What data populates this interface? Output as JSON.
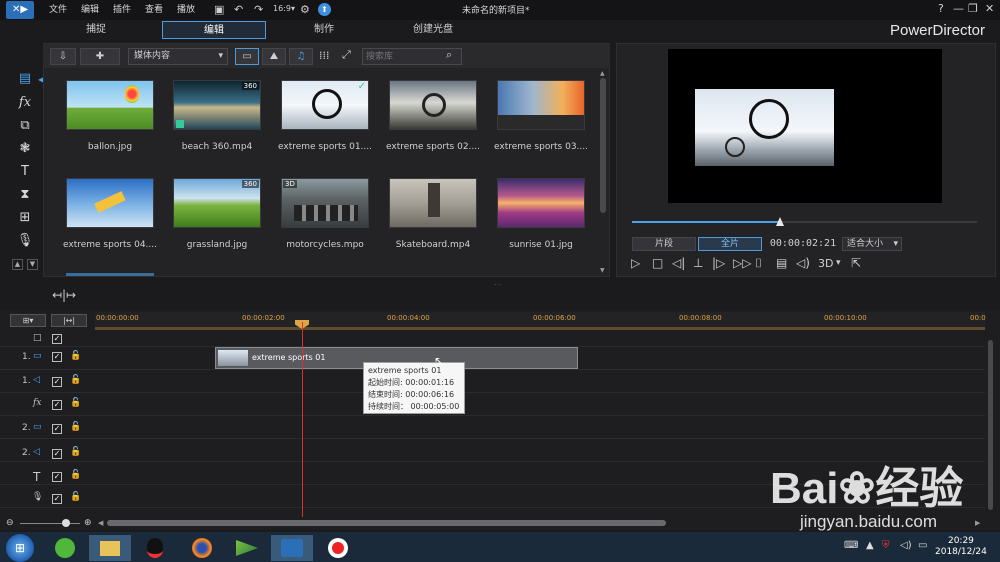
{
  "titlebar": {
    "menus": [
      "文件",
      "编辑",
      "插件",
      "查看",
      "播放"
    ],
    "title": "未命名的新项目*",
    "window_buttons": [
      "?",
      "—",
      "❐",
      "✕"
    ]
  },
  "tabs": [
    {
      "label": "捕捉",
      "active": false
    },
    {
      "label": "编辑",
      "active": true
    },
    {
      "label": "制作",
      "active": false
    },
    {
      "label": "创建光盘",
      "active": false
    }
  ],
  "brand": "PowerDirector",
  "library": {
    "content_select": "媒体内容",
    "search_placeholder": "搜索库",
    "items": [
      {
        "label": "ballon.jpg",
        "badge": ""
      },
      {
        "label": "beach 360.mp4",
        "badge": "360"
      },
      {
        "label": "extreme sports 01....",
        "badge": "✓"
      },
      {
        "label": "extreme sports 02....",
        "badge": ""
      },
      {
        "label": "extreme sports 03....",
        "badge": ""
      },
      {
        "label": "extreme sports 04....",
        "badge": ""
      },
      {
        "label": "grassland.jpg",
        "badge": "360"
      },
      {
        "label": "motorcycles.mpo",
        "badge": "3D"
      },
      {
        "label": "Skateboard.mp4",
        "badge": ""
      },
      {
        "label": "sunrise 01.jpg",
        "badge": ""
      }
    ]
  },
  "preview": {
    "clip_btn": "片段",
    "full_btn": "全片",
    "timecode": "00:00:02:21",
    "fit": "适合大小",
    "three_d": "3D",
    "seek_progress": 0.43
  },
  "timeline": {
    "ruler": [
      "00:00:00:00",
      "00:00:02:00",
      "00:00:04:00",
      "00:00:06:00",
      "00:00:08:00",
      "00:00:10:00",
      "00:0"
    ],
    "tracks": [
      {
        "num": "",
        "icon": "□"
      },
      {
        "num": "1.",
        "icon": "▭"
      },
      {
        "num": "1.",
        "icon": "◁"
      },
      {
        "num": "",
        "icon": "fx"
      },
      {
        "num": "2.",
        "icon": "▭"
      },
      {
        "num": "2.",
        "icon": "◁"
      },
      {
        "num": "",
        "icon": "T"
      },
      {
        "num": "",
        "icon": "🎙"
      }
    ],
    "clip_label": "extreme sports 01",
    "tooltip": {
      "title": "extreme sports 01",
      "start": "起始时间: 00:00:01:16",
      "end": "结束时间: 00:00:06:16",
      "duration": "持续时间： 00:00:05:00"
    }
  },
  "taskbar": {
    "time": "20:29",
    "date": "2018/12/24"
  },
  "watermark": {
    "logo": "Bai❀经验",
    "url": "jingyan.baidu.com"
  }
}
